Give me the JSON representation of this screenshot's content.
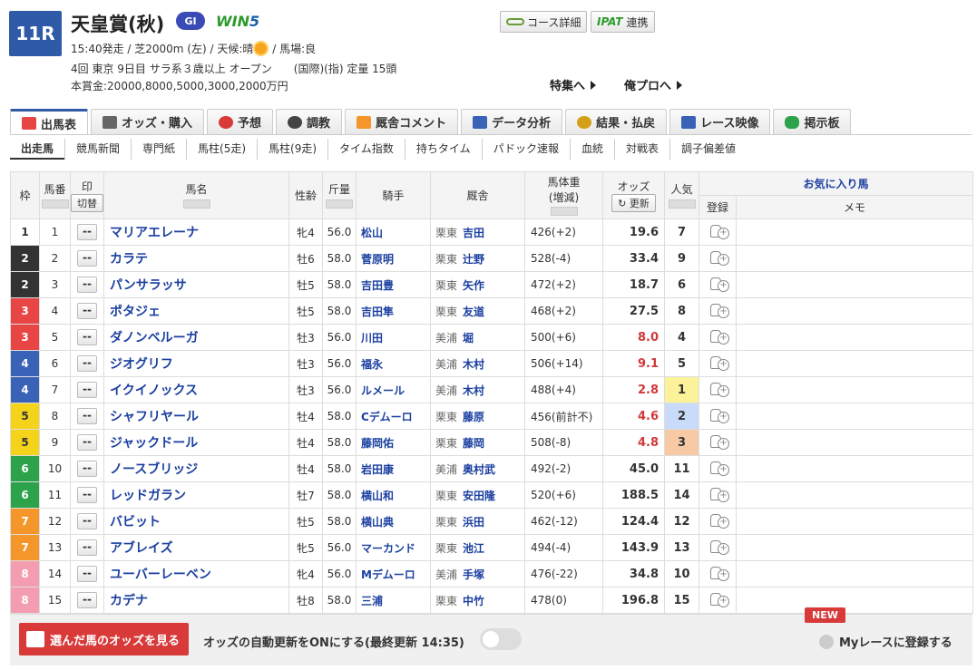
{
  "header": {
    "race_number": "11R",
    "race_name": "天皇賞(秋)",
    "grade": "GI",
    "win5_w": "WIN",
    "win5_5": "5",
    "line1_a": "15:40発走 / 芝2000m (左) / 天候:晴",
    "line1_b": " / 馬場:良",
    "line2": "4回 東京 9日目 サラ系３歳以上 オープン　　(国際)(指) 定量 15頭",
    "line3": "本賞金:20000,8000,5000,3000,2000万円",
    "course_button": "コース詳細",
    "ipat_logo": "IPAT",
    "ipat_label": "連携",
    "special_link": "特集へ",
    "mypro_link": "俺プロへ"
  },
  "tabs": [
    {
      "label": "出馬表",
      "color": "#e84545"
    },
    {
      "label": "オッズ・購入",
      "color": "#666"
    },
    {
      "label": "予想",
      "color": "#d83a3a"
    },
    {
      "label": "調教",
      "color": "#444"
    },
    {
      "label": "厩舎コメント",
      "color": "#f5962a"
    },
    {
      "label": "データ分析",
      "color": "#3a63b8"
    },
    {
      "label": "結果・払戻",
      "color": "#d4a017"
    },
    {
      "label": "レース映像",
      "color": "#3a63b8"
    },
    {
      "label": "掲示板",
      "color": "#2ca24b"
    }
  ],
  "subtabs": [
    "出走馬",
    "競馬新聞",
    "専門紙",
    "馬柱(5走)",
    "馬柱(9走)",
    "タイム指数",
    "持ちタイム",
    "パドック速報",
    "血統",
    "対戦表",
    "調子偏差値"
  ],
  "table_header": {
    "waku": "枠",
    "umaban": "馬番",
    "mark": "印",
    "mark_switch": "切替",
    "horse": "馬名",
    "sexage": "性齢",
    "weight": "斤量",
    "jockey": "騎手",
    "stable": "厩舎",
    "body_weight": "馬体重",
    "body_weight_sub": "(増減)",
    "odds": "オッズ",
    "odds_update": "更新",
    "popularity": "人気",
    "favorites": "お気に入り馬",
    "register": "登録",
    "memo": "メモ"
  },
  "rows": [
    {
      "waku": "1",
      "num": "1",
      "mark": "--",
      "name": "マリアエレーナ",
      "sex": "牝4",
      "kinryo": "56.0",
      "jockey": "松山",
      "loc": "栗東",
      "trainer": "吉田",
      "bw": "426(+2)",
      "odds": "19.6",
      "pop": "7"
    },
    {
      "waku": "2",
      "num": "2",
      "mark": "--",
      "name": "カラテ",
      "sex": "牡6",
      "kinryo": "58.0",
      "jockey": "菅原明",
      "loc": "栗東",
      "trainer": "辻野",
      "bw": "528(-4)",
      "odds": "33.4",
      "pop": "9"
    },
    {
      "waku": "2",
      "num": "3",
      "mark": "--",
      "name": "パンサラッサ",
      "sex": "牡5",
      "kinryo": "58.0",
      "jockey": "吉田豊",
      "loc": "栗東",
      "trainer": "矢作",
      "bw": "472(+2)",
      "odds": "18.7",
      "pop": "6"
    },
    {
      "waku": "3",
      "num": "4",
      "mark": "--",
      "name": "ポタジェ",
      "sex": "牡5",
      "kinryo": "58.0",
      "jockey": "吉田隼",
      "loc": "栗東",
      "trainer": "友道",
      "bw": "468(+2)",
      "odds": "27.5",
      "pop": "8"
    },
    {
      "waku": "3",
      "num": "5",
      "mark": "--",
      "name": "ダノンベルーガ",
      "sex": "牡3",
      "kinryo": "56.0",
      "jockey": "川田",
      "loc": "美浦",
      "trainer": "堀",
      "bw": "500(+6)",
      "odds": "8.0",
      "pop": "4"
    },
    {
      "waku": "4",
      "num": "6",
      "mark": "--",
      "name": "ジオグリフ",
      "sex": "牡3",
      "kinryo": "56.0",
      "jockey": "福永",
      "loc": "美浦",
      "trainer": "木村",
      "bw": "506(+14)",
      "odds": "9.1",
      "pop": "5"
    },
    {
      "waku": "4",
      "num": "7",
      "mark": "--",
      "name": "イクイノックス",
      "sex": "牡3",
      "kinryo": "56.0",
      "jockey": "ルメール",
      "loc": "美浦",
      "trainer": "木村",
      "bw": "488(+4)",
      "odds": "2.8",
      "pop": "1"
    },
    {
      "waku": "5",
      "num": "8",
      "mark": "--",
      "name": "シャフリヤール",
      "sex": "牡4",
      "kinryo": "58.0",
      "jockey": "Cデムーロ",
      "loc": "栗東",
      "trainer": "藤原",
      "bw": "456(前計不)",
      "odds": "4.6",
      "pop": "2"
    },
    {
      "waku": "5",
      "num": "9",
      "mark": "--",
      "name": "ジャックドール",
      "sex": "牡4",
      "kinryo": "58.0",
      "jockey": "藤岡佑",
      "loc": "栗東",
      "trainer": "藤岡",
      "bw": "508(-8)",
      "odds": "4.8",
      "pop": "3"
    },
    {
      "waku": "6",
      "num": "10",
      "mark": "--",
      "name": "ノースブリッジ",
      "sex": "牡4",
      "kinryo": "58.0",
      "jockey": "岩田康",
      "loc": "美浦",
      "trainer": "奥村武",
      "bw": "492(-2)",
      "odds": "45.0",
      "pop": "11"
    },
    {
      "waku": "6",
      "num": "11",
      "mark": "--",
      "name": "レッドガラン",
      "sex": "牡7",
      "kinryo": "58.0",
      "jockey": "横山和",
      "loc": "栗東",
      "trainer": "安田隆",
      "bw": "520(+6)",
      "odds": "188.5",
      "pop": "14"
    },
    {
      "waku": "7",
      "num": "12",
      "mark": "--",
      "name": "バビット",
      "sex": "牡5",
      "kinryo": "58.0",
      "jockey": "横山典",
      "loc": "栗東",
      "trainer": "浜田",
      "bw": "462(-12)",
      "odds": "124.4",
      "pop": "12"
    },
    {
      "waku": "7",
      "num": "13",
      "mark": "--",
      "name": "アブレイズ",
      "sex": "牝5",
      "kinryo": "56.0",
      "jockey": "マーカンド",
      "loc": "栗東",
      "trainer": "池江",
      "bw": "494(-4)",
      "odds": "143.9",
      "pop": "13"
    },
    {
      "waku": "8",
      "num": "14",
      "mark": "--",
      "name": "ユーバーレーベン",
      "sex": "牝4",
      "kinryo": "56.0",
      "jockey": "Mデムーロ",
      "loc": "美浦",
      "trainer": "手塚",
      "bw": "476(-22)",
      "odds": "34.8",
      "pop": "10"
    },
    {
      "waku": "8",
      "num": "15",
      "mark": "--",
      "name": "カデナ",
      "sex": "牡8",
      "kinryo": "58.0",
      "jockey": "三浦",
      "loc": "栗東",
      "trainer": "中竹",
      "bw": "478(0)",
      "odds": "196.8",
      "pop": "15"
    }
  ],
  "bottom": {
    "odds_button": "選んだ馬のオッズを見る",
    "auto_update": "オッズの自動更新をONにする(最終更新 14:35)",
    "new_badge": "NEW",
    "my_race": "Myレースに登録する"
  }
}
